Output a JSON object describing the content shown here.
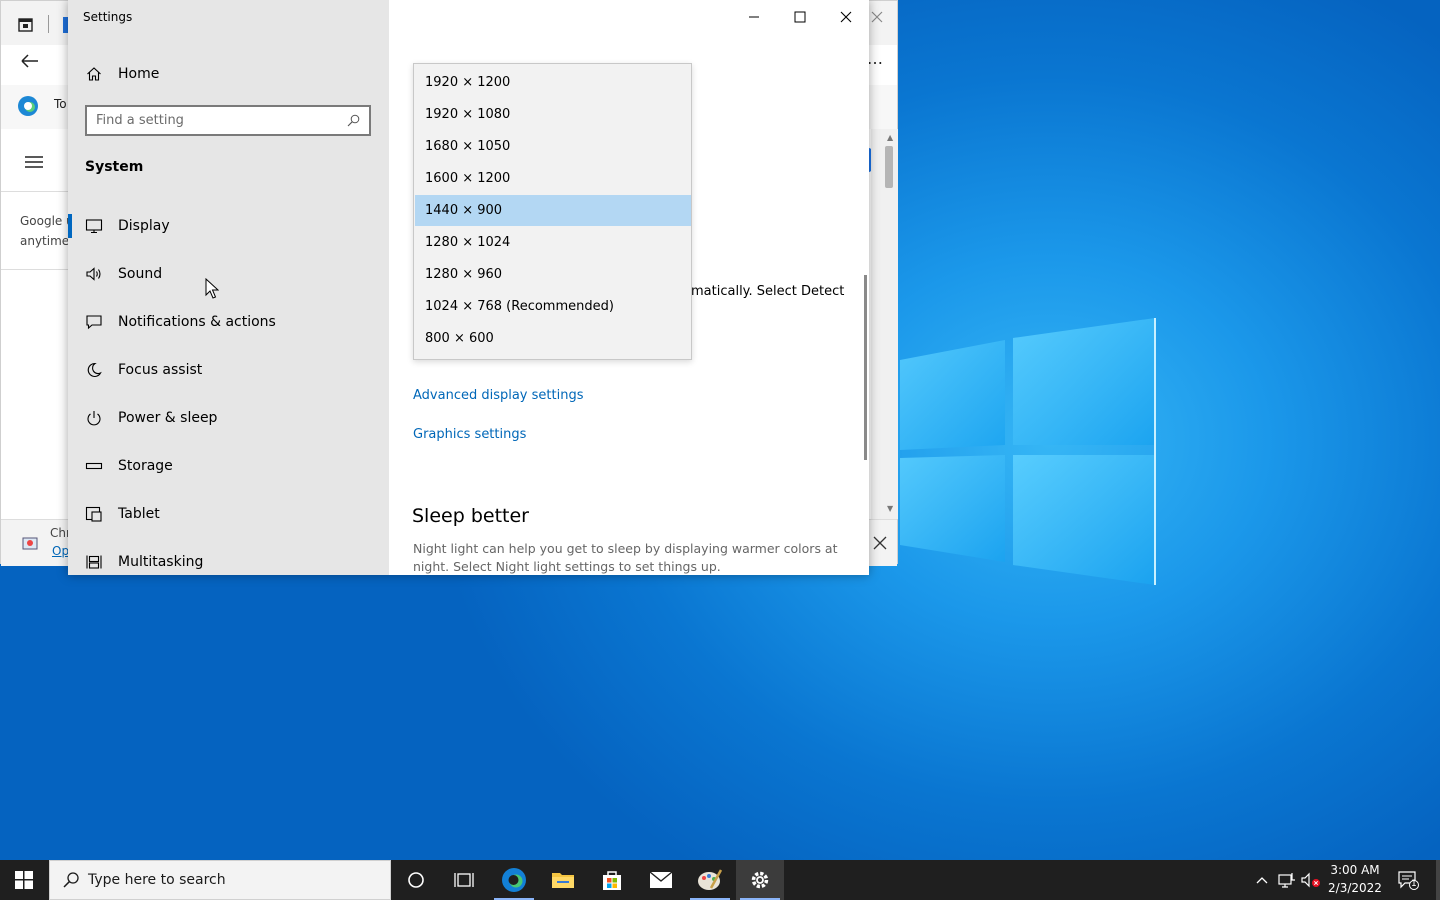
{
  "settings": {
    "title": "Settings",
    "home_label": "Home",
    "search_placeholder": "Find a setting",
    "section_label": "System",
    "nav_items": [
      {
        "label": "Display",
        "icon": "monitor-icon"
      },
      {
        "label": "Sound",
        "icon": "speaker-icon"
      },
      {
        "label": "Notifications & actions",
        "icon": "notification-icon"
      },
      {
        "label": "Focus assist",
        "icon": "moon-icon"
      },
      {
        "label": "Power & sleep",
        "icon": "power-icon"
      },
      {
        "label": "Storage",
        "icon": "storage-icon"
      },
      {
        "label": "Tablet",
        "icon": "tablet-icon"
      },
      {
        "label": "Multitasking",
        "icon": "multitasking-icon"
      }
    ],
    "active_nav": "Display",
    "content": {
      "resolution_options": [
        "1920 × 1200",
        "1920 × 1080",
        "1680 × 1050",
        "1600 × 1200",
        "1440 × 900",
        "1280 × 1024",
        "1280 × 960",
        "1024 × 768 (Recommended)",
        "800 × 600"
      ],
      "selected_resolution": "1440 × 900",
      "partial_text": "matically. Select Detect",
      "advanced_link": "Advanced display settings",
      "graphics_link": "Graphics settings",
      "sleep_heading": "Sleep better",
      "sleep_desc": "Night light can help you get to sleep by displaying warmer colors at night. Select Night light settings to set things up."
    }
  },
  "browser": {
    "tab_partial": "To",
    "page_text_1": "Google u",
    "page_text_2": "anytime i",
    "bottom_text_1": "Chr",
    "bottom_text_2": "Op"
  },
  "taskbar": {
    "search_placeholder": "Type here to search",
    "time": "3:00 AM",
    "date": "2/3/2022",
    "notification_count": "1"
  },
  "colors": {
    "accent": "#0067c0",
    "link": "#0067b8",
    "selected_item": "#b3d7f3"
  }
}
